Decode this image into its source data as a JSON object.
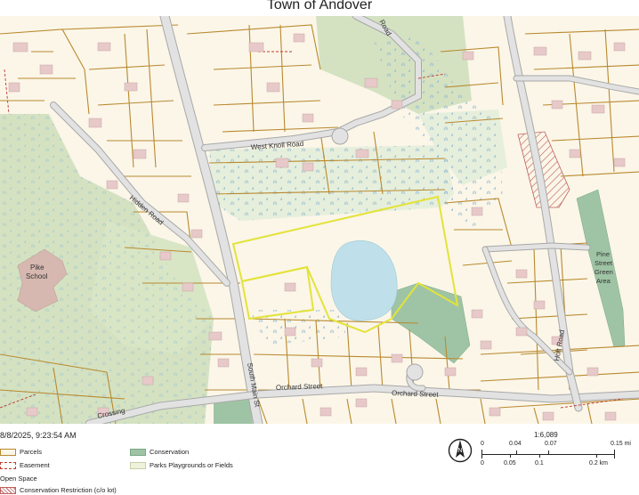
{
  "title": "Town of Andover",
  "timestamp": "8/8/2025, 9:23:54 AM",
  "map": {
    "labels": {
      "west_knoll_road": "West Knoll Road",
      "hidden_road": "Hidden Road",
      "south_main_street": "South Main St",
      "orchard_street_1": "Orchard Street",
      "orchard_street_2": "Orchard Street",
      "holt_road": "Holt Road",
      "crossing": "Crossing",
      "road_top": "Road",
      "pike_school": [
        "Pike",
        "School"
      ],
      "pine_street_green": [
        "Pine",
        "Street",
        "Green",
        "Area"
      ]
    },
    "colors": {
      "background": "#fbf6e8",
      "parcel_line": "#b9892f",
      "road": "#d7d7d7",
      "road_edge": "#a8a8a8",
      "conservation": "#9fc4a5",
      "parks": "#dfe9cf",
      "woods": "#d4e2c2",
      "pond": "#bfe0ea",
      "buildings": "#e7c9c9",
      "highlight": "#e3e33a",
      "easement": "#c0392b"
    }
  },
  "legend": {
    "items": [
      {
        "label": "Parcels",
        "swatch": "parcel"
      },
      {
        "label": "Easement",
        "swatch": "easement"
      },
      {
        "label": "Open Space",
        "swatch": "none"
      },
      {
        "label": "Conservation Restriction (c/o lot)",
        "swatch": "restriction"
      },
      {
        "label": "Conservation",
        "swatch": "conservation"
      },
      {
        "label": "Parks Playgrounds or Fields",
        "swatch": "parks"
      }
    ]
  },
  "scale": {
    "ratio": "1:6,089",
    "mi_ticks": [
      "0",
      "0.04",
      "0.07",
      "0.15 mi"
    ],
    "km_ticks": [
      "0",
      "0.05",
      "0.1",
      "0.2 km"
    ]
  },
  "north_arrow": {
    "letter": "N",
    "icon": "north-arrow-icon"
  }
}
